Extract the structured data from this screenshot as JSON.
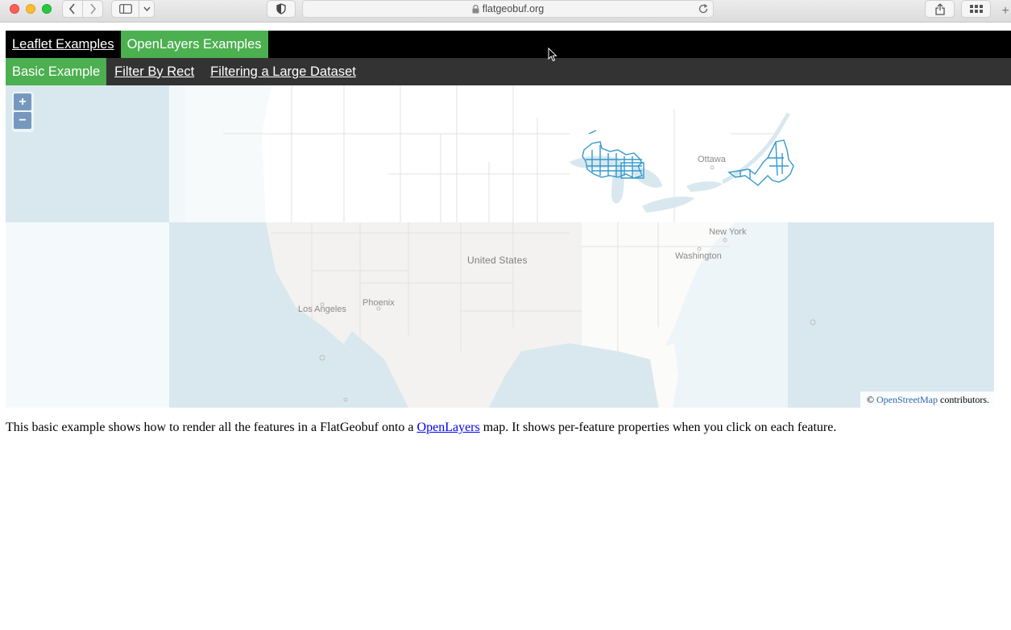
{
  "browser": {
    "url": "flatgeobuf.org",
    "icons": [
      "back-icon",
      "forward-icon",
      "sidebar-icon",
      "chevron-down-icon",
      "shield-icon",
      "lock-icon",
      "reload-icon",
      "share-icon",
      "tab-overview-icon",
      "plus-icon"
    ],
    "new_tab_label": "+"
  },
  "top_nav": {
    "items": [
      {
        "label": "Leaflet Examples",
        "active": false
      },
      {
        "label": "OpenLayers Examples",
        "active": true
      }
    ]
  },
  "sub_nav": {
    "items": [
      {
        "label": "Basic Example",
        "active": true
      },
      {
        "label": "Filter By Rect",
        "active": false
      },
      {
        "label": "Filtering a Large Dataset",
        "active": false
      }
    ]
  },
  "map": {
    "zoom_in_label": "+",
    "zoom_out_label": "−",
    "labels": {
      "country": "United States",
      "ottawa": "Ottawa",
      "new_york": "New York",
      "washington": "Washington",
      "phoenix": "Phoenix",
      "los_angeles": "Los Angeles"
    },
    "attribution": {
      "prefix": "©",
      "link": "OpenStreetMap",
      "suffix": "contributors."
    },
    "colors": {
      "water": "#d8e7ee",
      "land": "#f2f2f0",
      "feature_stroke": "#3399cc",
      "accent": "#4caf50"
    }
  },
  "description": {
    "before": "This basic example shows how to render all the features in a FlatGeobuf onto a ",
    "link": "OpenLayers",
    "after": " map. It shows per-feature properties when you click on each feature."
  }
}
